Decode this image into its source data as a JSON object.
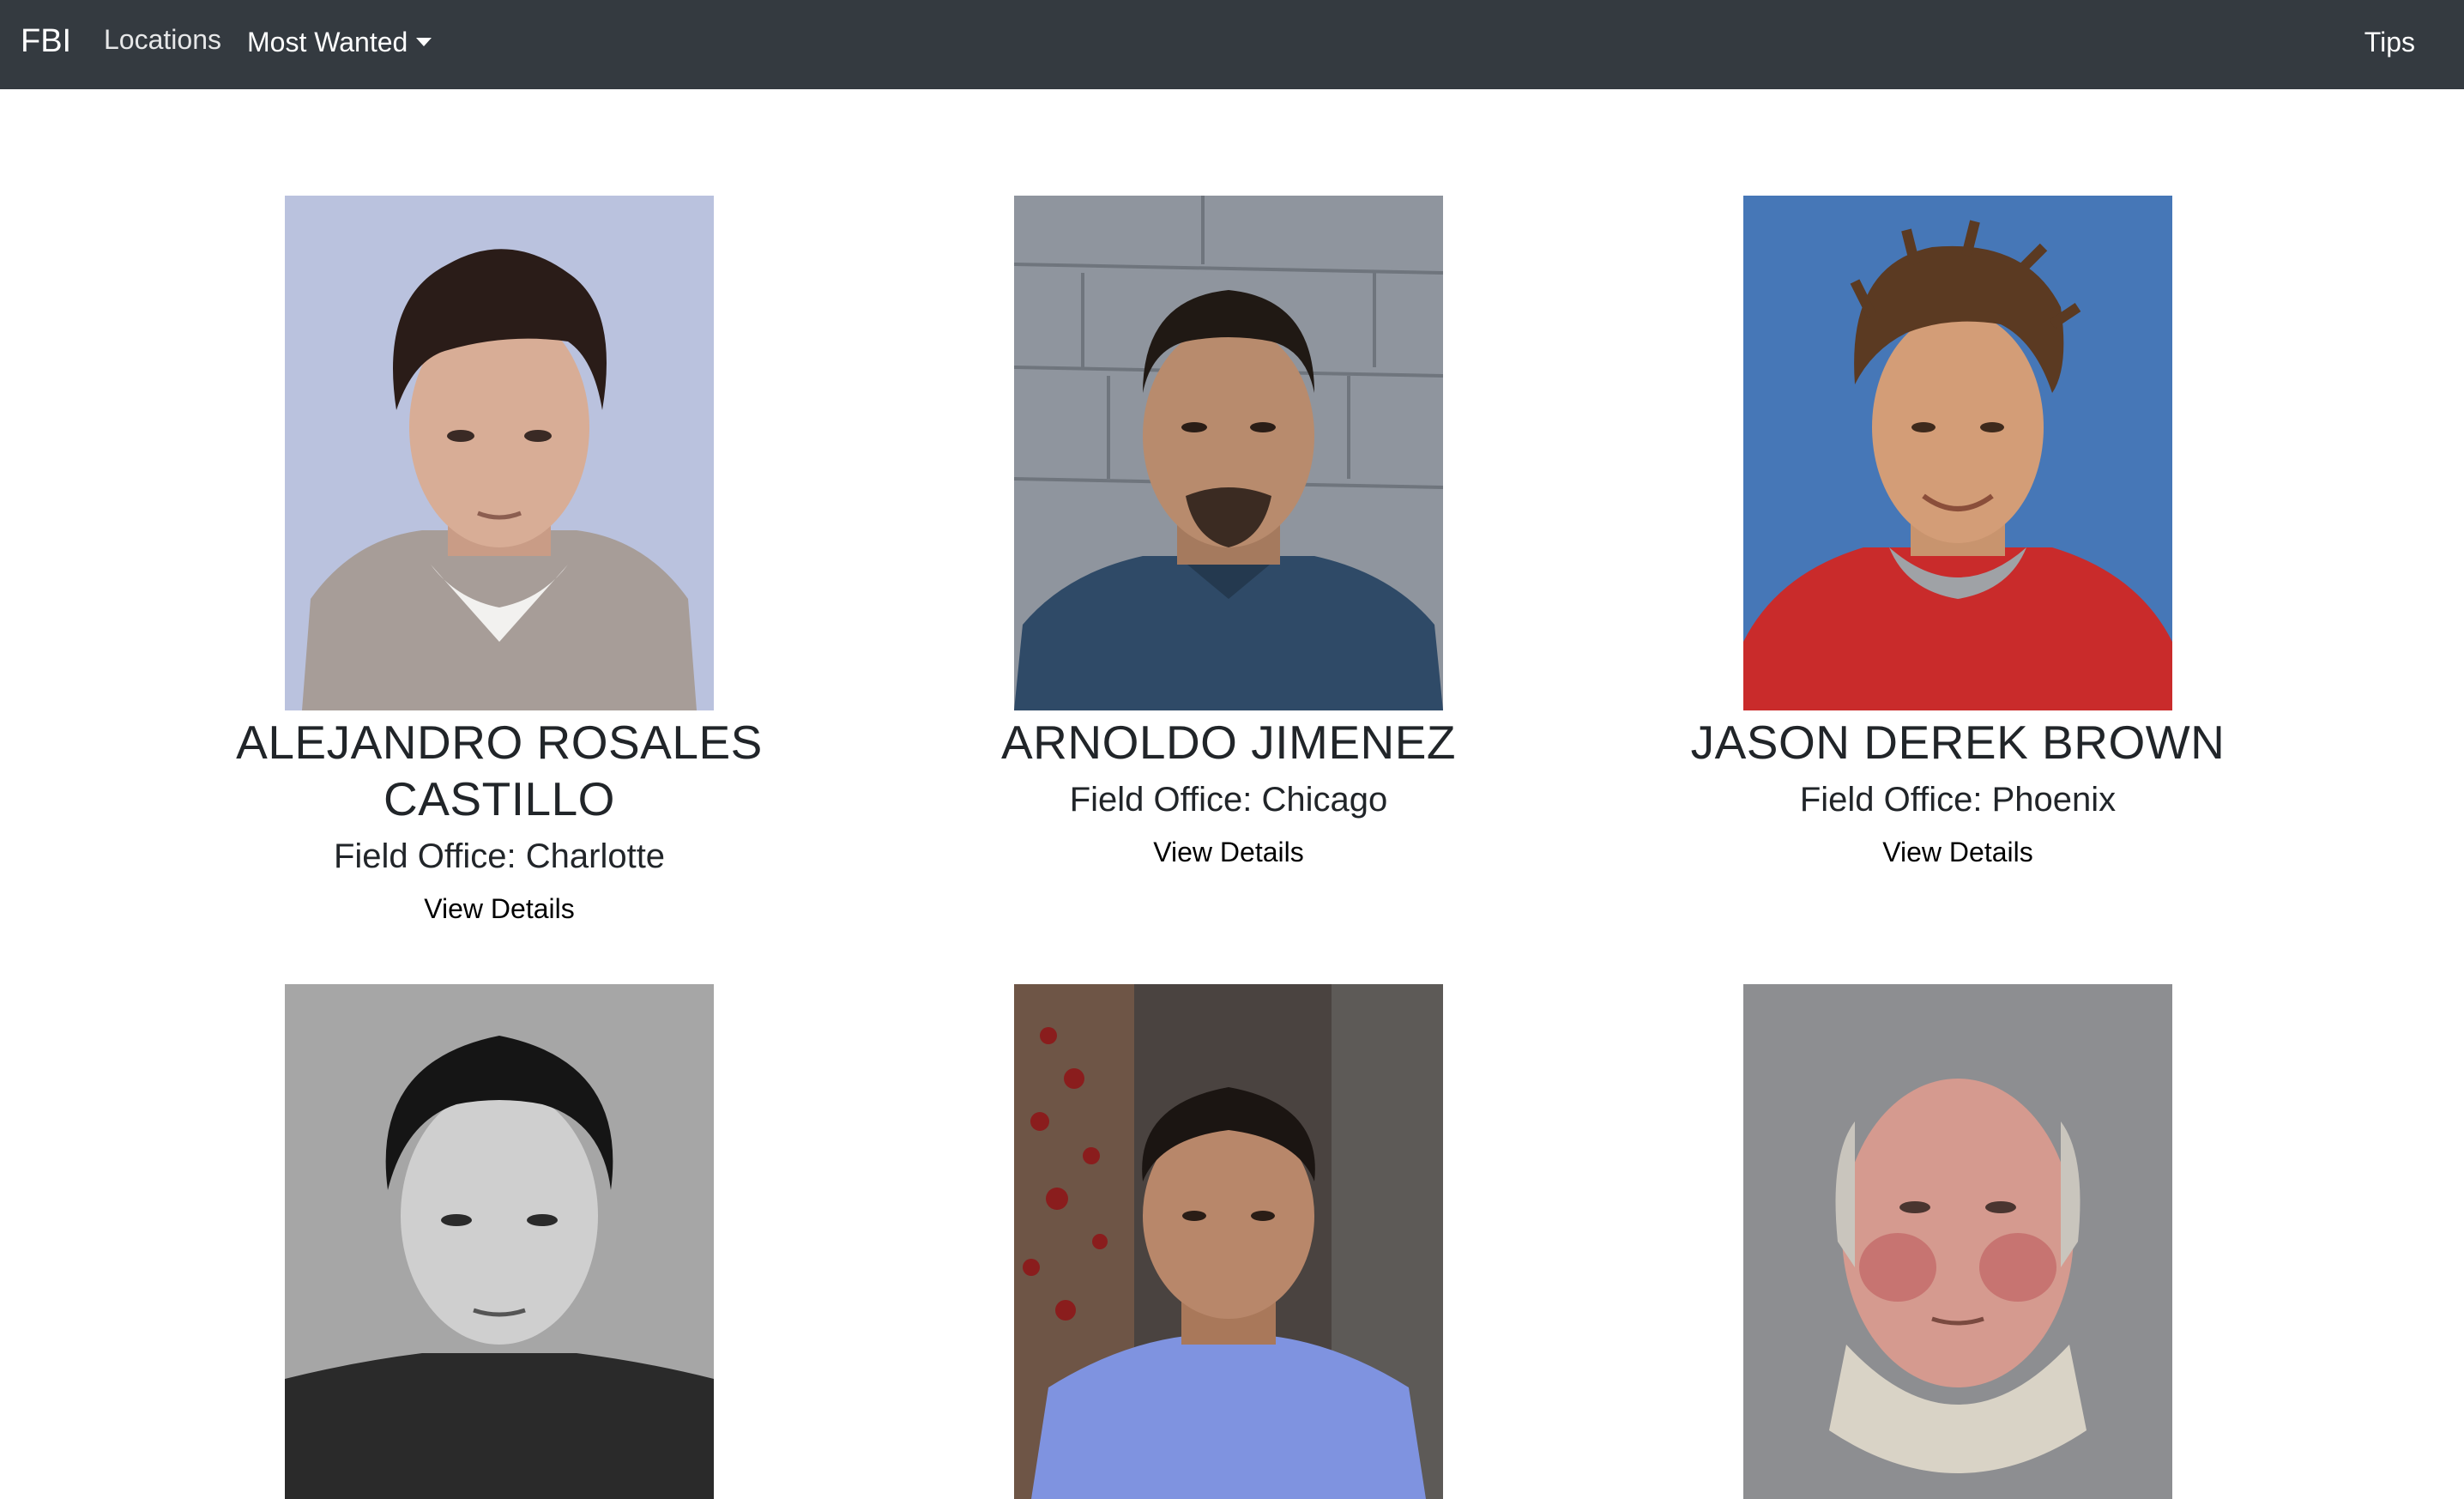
{
  "navbar": {
    "brand": "FBI",
    "links": {
      "locations": "Locations",
      "most_wanted": "Most Wanted",
      "tips": "Tips"
    }
  },
  "people": [
    {
      "name": "ALEJANDRO ROSALES CASTILLO",
      "office": "Field Office: Charlotte",
      "details_label": "View Details"
    },
    {
      "name": "ARNOLDO JIMENEZ",
      "office": "Field Office: Chicago",
      "details_label": "View Details"
    },
    {
      "name": "JASON DEREK BROWN",
      "office": "Field Office: Phoenix",
      "details_label": "View Details"
    },
    {
      "name": "",
      "office": "",
      "details_label": ""
    },
    {
      "name": "",
      "office": "",
      "details_label": ""
    },
    {
      "name": "",
      "office": "",
      "details_label": ""
    }
  ]
}
